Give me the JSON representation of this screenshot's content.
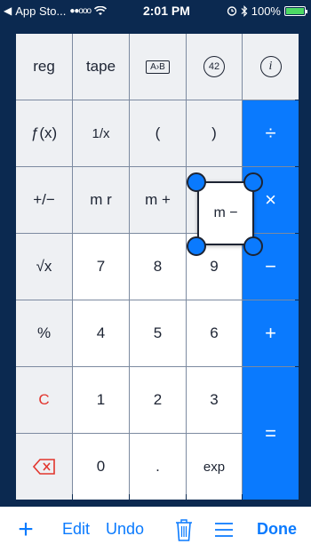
{
  "status_bar": {
    "carrier": "App Sto...",
    "signal": "●●ooo",
    "time": "2:01 PM",
    "battery": "100%"
  },
  "keys": {
    "reg": "reg",
    "tape": "tape",
    "convert": "A›B",
    "constant": "42",
    "info": "i",
    "function": "ƒ(x)",
    "reciprocal": "1/x",
    "paren_open": "(",
    "paren_close": ")",
    "divide": "÷",
    "plus_minus": "+/−",
    "mem_recall": "m r",
    "mem_plus": "m +",
    "mem_minus": "m −",
    "multiply": "×",
    "sqrt": "√x",
    "seven": "7",
    "eight": "8",
    "nine": "9",
    "subtract": "−",
    "percent": "%",
    "four": "4",
    "five": "5",
    "six": "6",
    "add": "+",
    "clear": "C",
    "one": "1",
    "two": "2",
    "three": "3",
    "equals": "=",
    "zero": "0",
    "decimal": ".",
    "exp": "exp"
  },
  "toolbar": {
    "add": "+",
    "edit": "Edit",
    "undo": "Undo",
    "done": "Done"
  },
  "colors": {
    "background": "#0b2950",
    "accent": "#0a7afe",
    "clear_red": "#e2352d"
  },
  "icons": [
    "backspace-icon",
    "trash-icon",
    "menu-icon",
    "wifi-icon",
    "bluetooth-icon",
    "alarm-icon"
  ]
}
